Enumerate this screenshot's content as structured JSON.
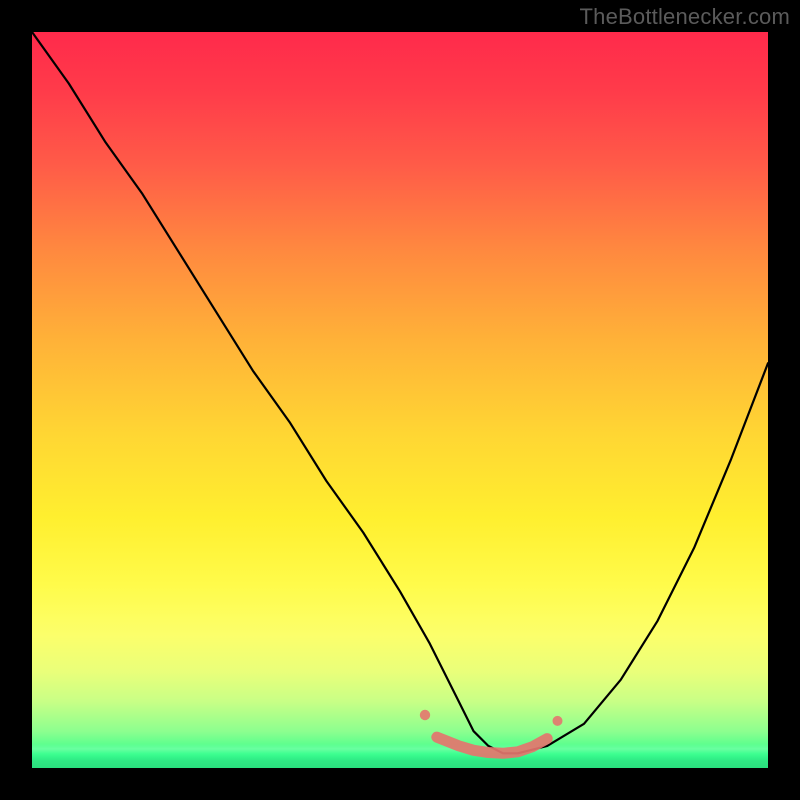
{
  "watermark": "TheBottlenecker.com",
  "chart_data": {
    "type": "line",
    "title": "",
    "xlabel": "",
    "ylabel": "",
    "xlim": [
      0,
      100
    ],
    "ylim": [
      0,
      100
    ],
    "series": [
      {
        "name": "bottleneck-curve",
        "x": [
          0,
          5,
          10,
          15,
          20,
          25,
          30,
          35,
          40,
          45,
          50,
          54,
          58,
          60,
          62,
          64,
          66,
          70,
          75,
          80,
          85,
          90,
          95,
          100
        ],
        "y": [
          100,
          93,
          85,
          78,
          70,
          62,
          54,
          47,
          39,
          32,
          24,
          17,
          9,
          5,
          3,
          2,
          2,
          3,
          6,
          12,
          20,
          30,
          42,
          55
        ]
      },
      {
        "name": "optimal-range-marker",
        "x": [
          55,
          58,
          60,
          62,
          64,
          66,
          68,
          70
        ],
        "y": [
          4.2,
          3.0,
          2.4,
          2.1,
          2.0,
          2.2,
          2.9,
          4.0
        ]
      }
    ],
    "colors": {
      "curve": "#000000",
      "marker": "#e4756e",
      "gradient_top": "#ff2a4b",
      "gradient_bottom": "#1dff7f"
    }
  }
}
